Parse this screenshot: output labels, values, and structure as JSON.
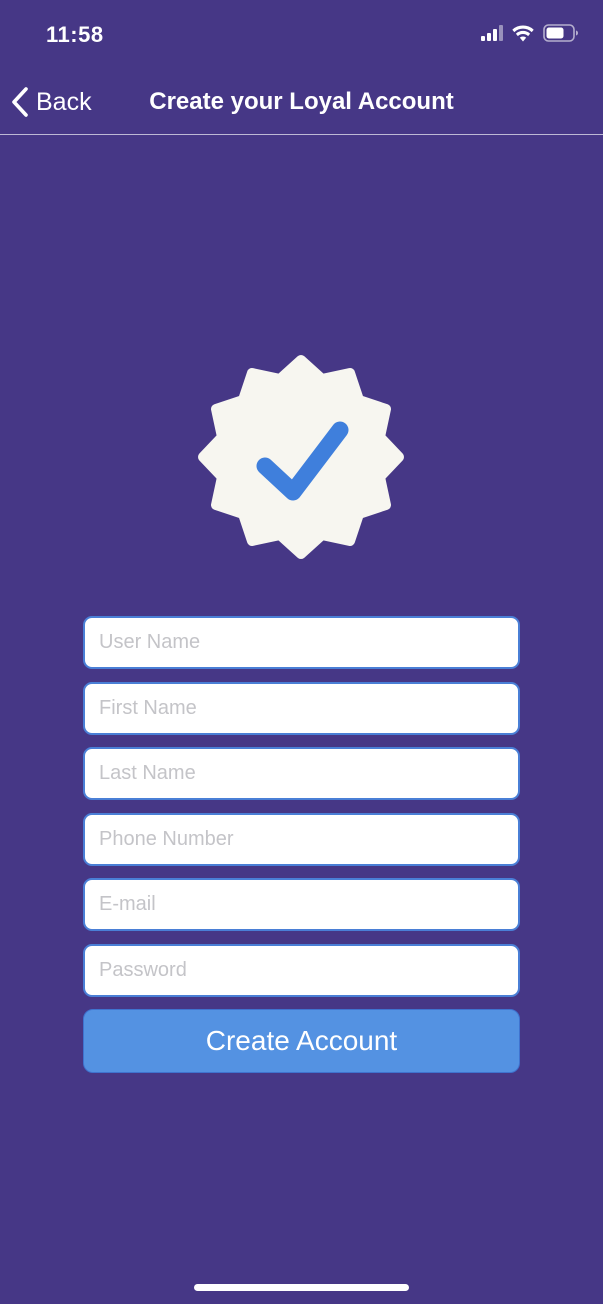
{
  "status_bar": {
    "time": "11:58",
    "icons": [
      "cellular-signal-icon",
      "wifi-icon",
      "battery-icon"
    ]
  },
  "nav": {
    "back_label": "Back",
    "back_icon": "chevron-left-icon",
    "title": "Create your Loyal Account"
  },
  "badge": {
    "icon": "verified-badge-icon",
    "badge_color": "#f7f6f0",
    "check_color": "#3f7fdc"
  },
  "form": {
    "fields": [
      {
        "placeholder": "User Name",
        "value": ""
      },
      {
        "placeholder": "First Name",
        "value": ""
      },
      {
        "placeholder": "Last Name",
        "value": ""
      },
      {
        "placeholder": "Phone Number",
        "value": ""
      },
      {
        "placeholder": "E-mail",
        "value": ""
      },
      {
        "placeholder": "Password",
        "value": ""
      }
    ],
    "submit_label": "Create Account"
  },
  "colors": {
    "background": "#463786",
    "button": "#5492e2",
    "field_border": "#4a7fd6"
  }
}
